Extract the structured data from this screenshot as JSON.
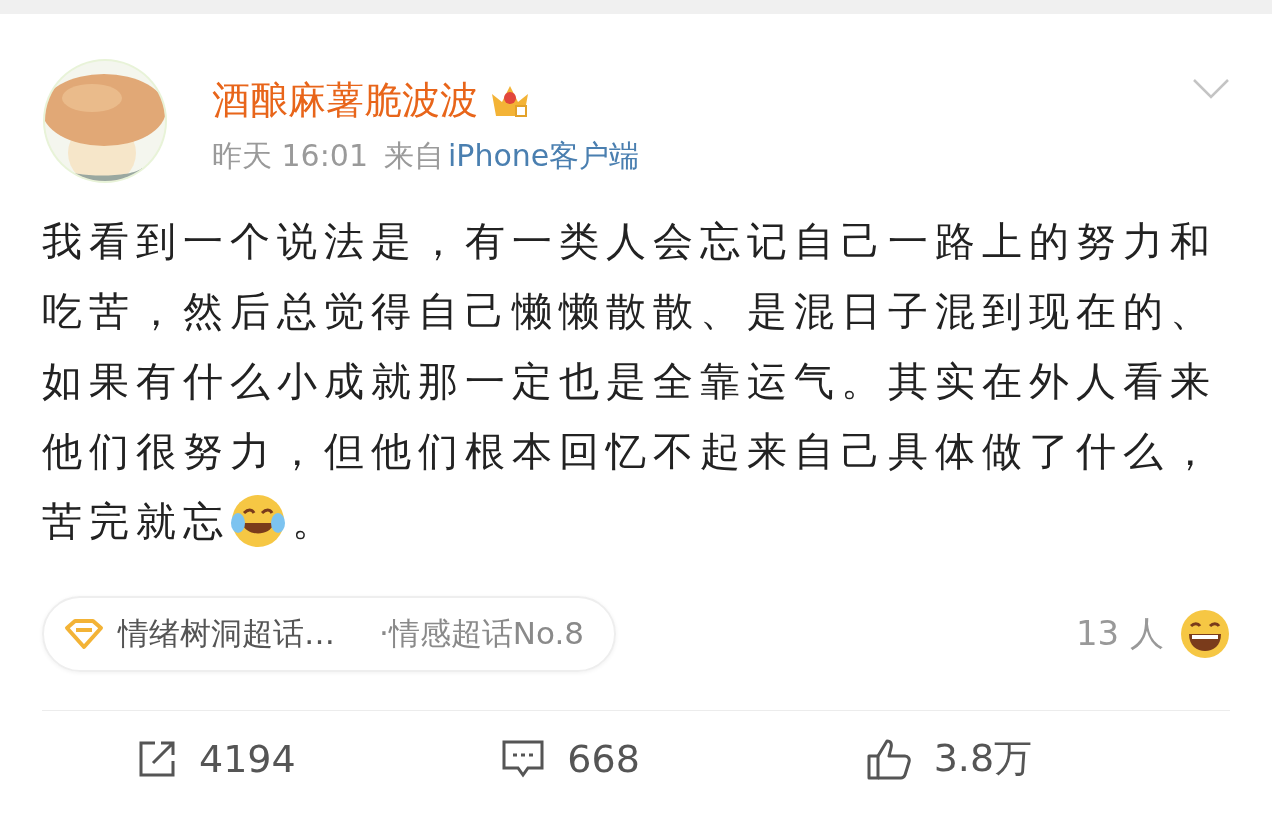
{
  "author": {
    "name": "酒酿麻薯脆波波",
    "time": "昨天 16:01",
    "source_prefix": "来自",
    "source": "iPhone客户端"
  },
  "post": {
    "lines": [
      "我看到一个说法是，有一类人会忘记自己一路上的努力和",
      "吃苦，然后总觉得自己懒懒散散、是混日子混到现在的、",
      "如果有什么小成就那一定也是全靠运气。其实在外人看来",
      "他们很努力，但他们根本回忆不起来自己具体做了什么，",
      "苦完就忘"
    ],
    "tail": "。"
  },
  "topic": {
    "name": "情绪树洞超话…",
    "rank": "·情感超话No.8"
  },
  "reactions": {
    "count": "13 人"
  },
  "actions": [
    {
      "kind": "repost",
      "count": "4194"
    },
    {
      "kind": "comment",
      "count": "668"
    },
    {
      "kind": "like",
      "count": "3.8万"
    }
  ]
}
